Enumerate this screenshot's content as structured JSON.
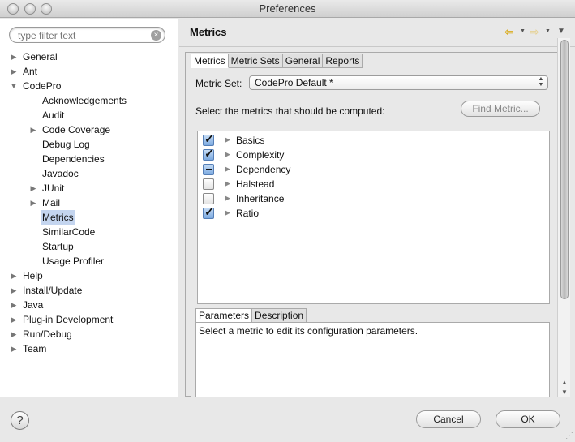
{
  "window": {
    "title": "Preferences"
  },
  "filter": {
    "placeholder": "type filter text"
  },
  "tree": [
    {
      "label": "General",
      "indent": 0,
      "toggle": "collapsed"
    },
    {
      "label": "Ant",
      "indent": 0,
      "toggle": "collapsed"
    },
    {
      "label": "CodePro",
      "indent": 0,
      "toggle": "expanded"
    },
    {
      "label": "Acknowledgements",
      "indent": 1,
      "toggle": "none"
    },
    {
      "label": "Audit",
      "indent": 1,
      "toggle": "none"
    },
    {
      "label": "Code Coverage",
      "indent": 1,
      "toggle": "collapsed"
    },
    {
      "label": "Debug Log",
      "indent": 1,
      "toggle": "none"
    },
    {
      "label": "Dependencies",
      "indent": 1,
      "toggle": "none"
    },
    {
      "label": "Javadoc",
      "indent": 1,
      "toggle": "none"
    },
    {
      "label": "JUnit",
      "indent": 1,
      "toggle": "collapsed"
    },
    {
      "label": "Mail",
      "indent": 1,
      "toggle": "collapsed"
    },
    {
      "label": "Metrics",
      "indent": 1,
      "toggle": "none",
      "selected": true
    },
    {
      "label": "SimilarCode",
      "indent": 1,
      "toggle": "none"
    },
    {
      "label": "Startup",
      "indent": 1,
      "toggle": "none"
    },
    {
      "label": "Usage Profiler",
      "indent": 1,
      "toggle": "none"
    },
    {
      "label": "Help",
      "indent": 0,
      "toggle": "collapsed"
    },
    {
      "label": "Install/Update",
      "indent": 0,
      "toggle": "collapsed"
    },
    {
      "label": "Java",
      "indent": 0,
      "toggle": "collapsed"
    },
    {
      "label": "Plug-in Development",
      "indent": 0,
      "toggle": "collapsed"
    },
    {
      "label": "Run/Debug",
      "indent": 0,
      "toggle": "collapsed"
    },
    {
      "label": "Team",
      "indent": 0,
      "toggle": "collapsed"
    }
  ],
  "page": {
    "title": "Metrics",
    "tabs": [
      {
        "label": "Metrics",
        "active": true
      },
      {
        "label": "Metric Sets",
        "active": false
      },
      {
        "label": "General",
        "active": false
      },
      {
        "label": "Reports",
        "active": false
      }
    ],
    "metric_set": {
      "label": "Metric Set:",
      "value": "CodePro Default *"
    },
    "select_prompt": "Select the metrics that should be computed:",
    "find_button": "Find Metric...",
    "metrics": [
      {
        "name": "Basics",
        "state": "checked"
      },
      {
        "name": "Complexity",
        "state": "checked"
      },
      {
        "name": "Dependency",
        "state": "mixed"
      },
      {
        "name": "Halstead",
        "state": "unchecked"
      },
      {
        "name": "Inheritance",
        "state": "unchecked"
      },
      {
        "name": "Ratio",
        "state": "checked"
      }
    ],
    "bottom_tabs": [
      {
        "label": "Parameters",
        "active": true
      },
      {
        "label": "Description",
        "active": false
      }
    ],
    "bottom_text": "Select a metric to edit its configuration parameters."
  },
  "buttons": {
    "cancel": "Cancel",
    "ok": "OK",
    "help": "?"
  }
}
